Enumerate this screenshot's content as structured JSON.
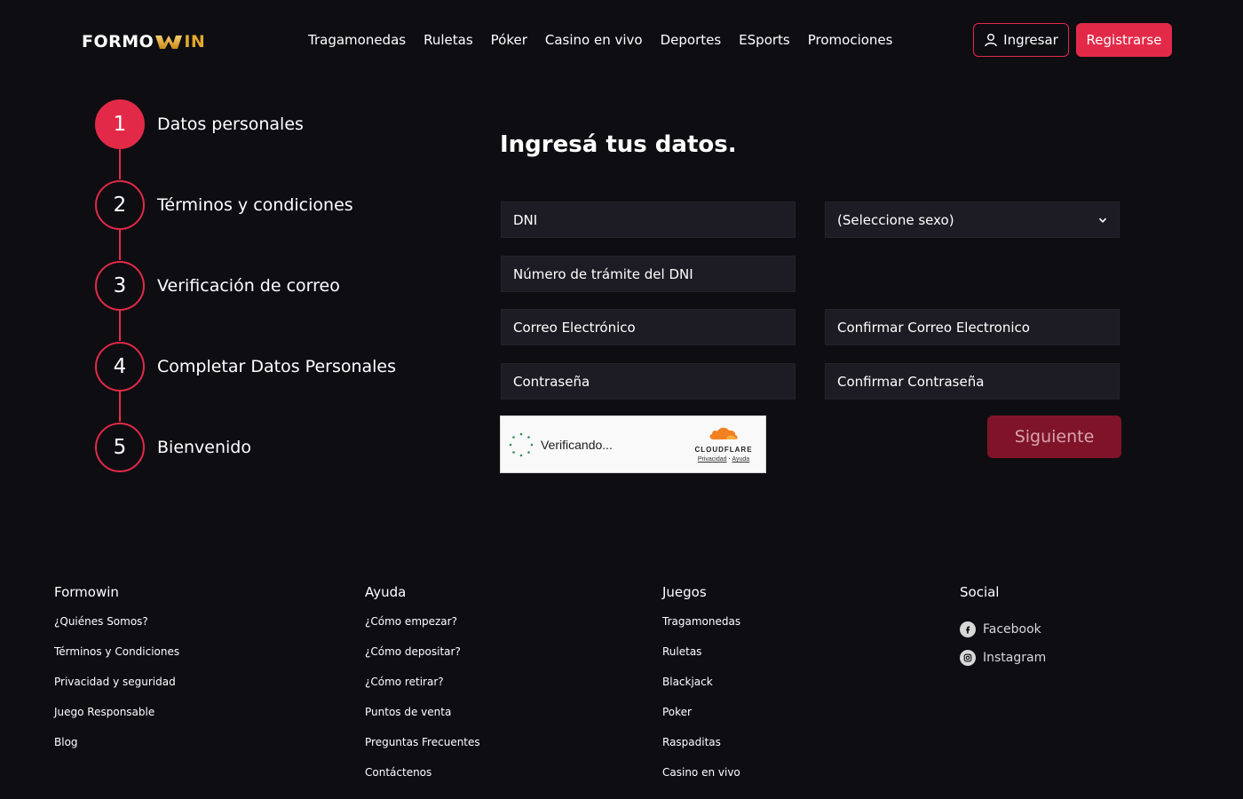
{
  "header": {
    "logo_main": "FORMO",
    "logo_end": "IN",
    "nav": [
      "Tragamonedas",
      "Ruletas",
      "Póker",
      "Casino en vivo",
      "Deportes",
      "ESports",
      "Promociones"
    ],
    "login_label": "Ingresar",
    "register_label": "Registrarse"
  },
  "steps": [
    {
      "number": "1",
      "label": "Datos personales",
      "active": true
    },
    {
      "number": "2",
      "label": "Términos y condiciones",
      "active": false
    },
    {
      "number": "3",
      "label": "Verificación de correo",
      "active": false
    },
    {
      "number": "4",
      "label": "Completar Datos Personales",
      "active": false
    },
    {
      "number": "5",
      "label": "Bienvenido",
      "active": false
    }
  ],
  "form": {
    "title": "Ingresá tus datos.",
    "dni_placeholder": "DNI",
    "sex_select": "(Seleccione sexo)",
    "tramite_placeholder": "Número de trámite del DNI",
    "email_placeholder": "Correo Electrónico",
    "confirm_email_placeholder": "Confirmar Correo Electronico",
    "password_placeholder": "Contraseña",
    "confirm_password_placeholder": "Confirmar Contraseña",
    "next_label": "Siguiente"
  },
  "captcha": {
    "status": "Verificando...",
    "brand": "CLOUDFLARE",
    "privacy": "Privacidad",
    "separator": "·",
    "help": "Ayuda"
  },
  "footer": {
    "formowin": {
      "title": "Formowin",
      "links": [
        "¿Quiénes Somos?",
        "Términos y Condiciones",
        "Privacidad y seguridad",
        "Juego Responsable",
        "Blog"
      ]
    },
    "ayuda": {
      "title": "Ayuda",
      "links": [
        "¿Cómo empezar?",
        "¿Cómo depositar?",
        "¿Cómo retirar?",
        "Puntos de venta",
        "Preguntas Frecuentes",
        "Contáctenos"
      ]
    },
    "juegos": {
      "title": "Juegos",
      "links": [
        "Tragamonedas",
        "Ruletas",
        "Blackjack",
        "Poker",
        "Raspaditas",
        "Casino en vivo"
      ]
    },
    "social": {
      "title": "Social",
      "links": [
        "Facebook",
        "Instagram"
      ]
    }
  },
  "colors": {
    "accent": "#e22a48",
    "background": "#0e0d12",
    "field": "#1d1c24",
    "next_button": "#7f1429",
    "logo_gold": "#e0a92d"
  },
  "icons": {
    "login": "user-icon",
    "select": "chevron-down-icon",
    "facebook": "facebook-icon",
    "instagram": "instagram-icon"
  }
}
